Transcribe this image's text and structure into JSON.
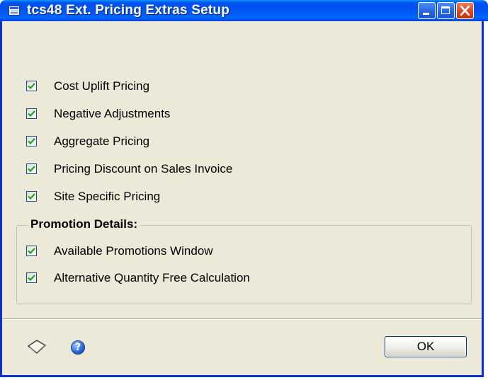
{
  "window": {
    "title": "tcs48 Ext. Pricing Extras Setup",
    "icons": {
      "app": "app-window-icon",
      "minimize": "minimize-icon",
      "maximize": "maximize-icon",
      "close": "close-icon"
    }
  },
  "options": [
    {
      "label": "Cost Uplift Pricing",
      "checked": true
    },
    {
      "label": "Negative Adjustments",
      "checked": true
    },
    {
      "label": "Aggregate Pricing",
      "checked": true
    },
    {
      "label": "Pricing Discount on Sales Invoice",
      "checked": true
    },
    {
      "label": "Site Specific Pricing",
      "checked": true
    }
  ],
  "promotion": {
    "title": "Promotion Details:",
    "options": [
      {
        "label": "Available Promotions Window",
        "checked": true
      },
      {
        "label": "Alternative Quantity Free Calculation",
        "checked": true
      }
    ]
  },
  "footer": {
    "note_icon": "note-icon",
    "help_icon": "help-icon",
    "ok_label": "OK"
  },
  "colors": {
    "titlebar": "#0053ee",
    "face": "#ece9d8",
    "checkmark": "#21a121",
    "close_button": "#d9451f"
  }
}
